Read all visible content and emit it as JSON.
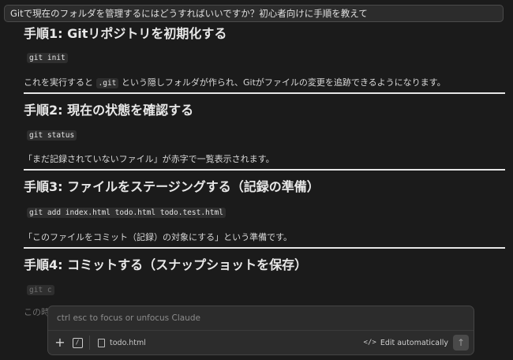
{
  "question": "Gitで現在のフォルダを管理するにはどうすればいいですか？初心者向けに手順を教えて",
  "steps": [
    {
      "title": "手順1: Gitリポジトリを初期化する",
      "code": "git init",
      "desc_before": "これを実行すると ",
      "desc_code": ".git",
      "desc_after": " という隠しフォルダが作られ、Gitがファイルの変更を追跡できるようになります。"
    },
    {
      "title": "手順2: 現在の状態を確認する",
      "code": "git status",
      "desc": "「まだ記録されていないファイル」が赤字で一覧表示されます。"
    },
    {
      "title": "手順3: ファイルをステージングする（記録の準備）",
      "code": "git add index.html todo.html todo.test.html",
      "desc": "「このファイルをコミット（記録）の対象にする」という準備です。"
    },
    {
      "title": "手順4: コミットする（スナップショットを保存）",
      "code": "git c",
      "desc": "この時"
    }
  ],
  "input": {
    "placeholder": "ctrl esc to focus or unfocus Claude",
    "file_name": "todo.html",
    "edit_mode": "Edit automatically",
    "add_icon": "plus-icon",
    "slash_icon": "slash-command-icon",
    "send_icon": "arrow-up-icon"
  }
}
